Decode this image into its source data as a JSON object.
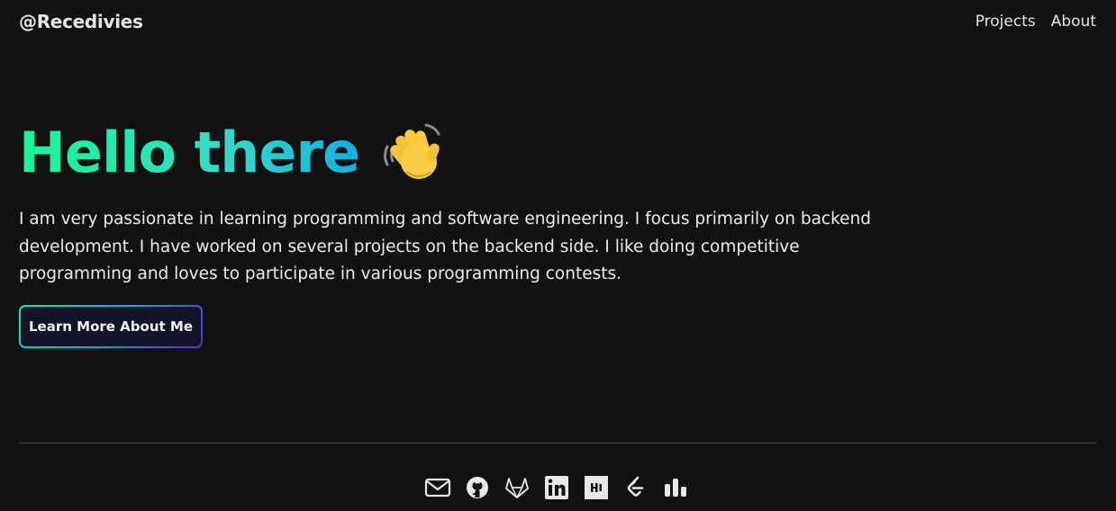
{
  "header": {
    "brand": "@Recedivies",
    "nav": [
      {
        "label": "Projects"
      },
      {
        "label": "About"
      }
    ]
  },
  "hero": {
    "title": "Hello there",
    "emoji": "waving-hand",
    "intro": "I am very passionate in learning programming and software engineering. I focus primarily on backend development. I have worked on several projects on the backend side. I like doing competitive programming and loves to participate in various programming contests.",
    "cta_label": "Learn More About Me"
  },
  "footer": {
    "socials": [
      {
        "icon": "mail-icon"
      },
      {
        "icon": "github-icon"
      },
      {
        "icon": "gitlab-icon"
      },
      {
        "icon": "linkedin-icon"
      },
      {
        "icon": "hackerrank-icon"
      },
      {
        "icon": "leetcode-icon"
      },
      {
        "icon": "stats-icon"
      }
    ]
  },
  "colors": {
    "background": "#121212",
    "gradient_start": "#17f59a",
    "gradient_end": "#11b0e0",
    "button_border_end": "#5b2bd9"
  }
}
